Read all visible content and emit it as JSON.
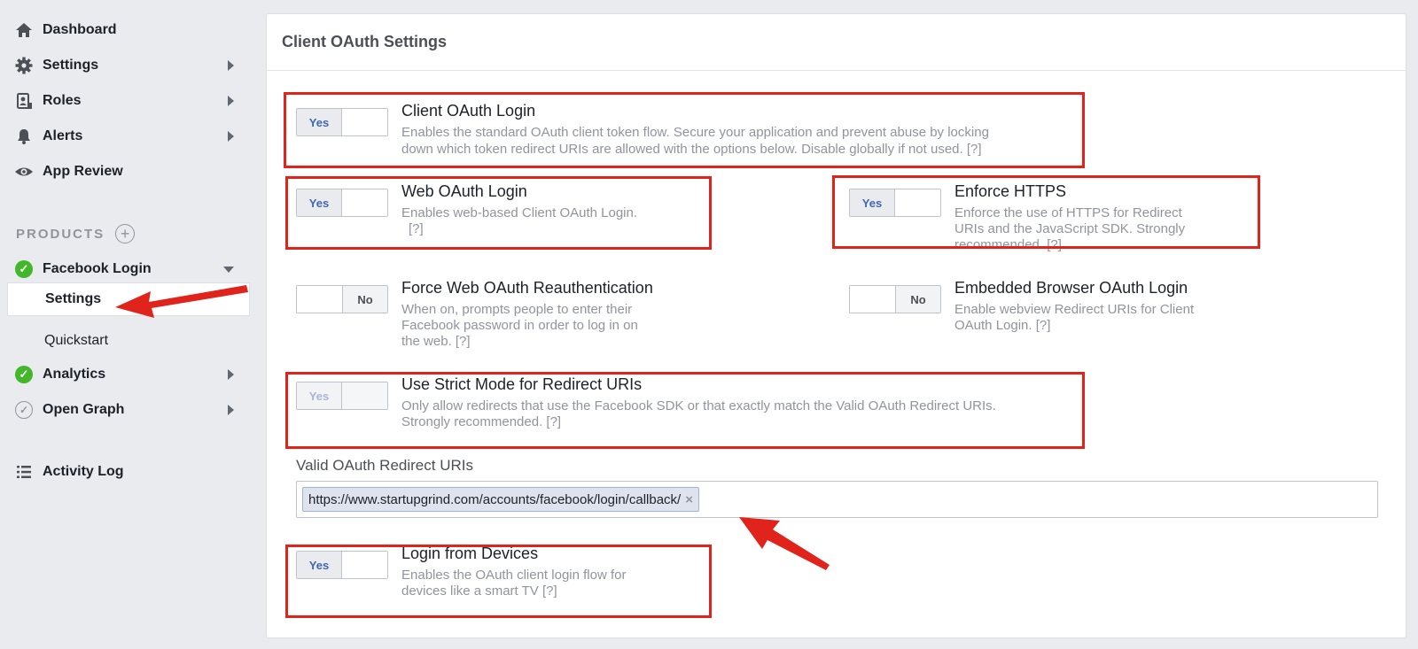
{
  "sidebar": {
    "nav": [
      {
        "label": "Dashboard",
        "icon": "home-icon"
      },
      {
        "label": "Settings",
        "icon": "gear-icon"
      },
      {
        "label": "Roles",
        "icon": "badge-icon"
      },
      {
        "label": "Alerts",
        "icon": "bell-icon"
      },
      {
        "label": "App Review",
        "icon": "eye-icon"
      }
    ],
    "products_heading": "PRODUCTS",
    "products": [
      {
        "label": "Facebook Login",
        "status": "active"
      },
      {
        "label": "Analytics",
        "status": "active"
      },
      {
        "label": "Open Graph",
        "status": "inactive"
      }
    ],
    "facebook_login_sub": [
      {
        "label": "Settings"
      },
      {
        "label": "Quickstart"
      }
    ],
    "activity_log": "Activity Log"
  },
  "panel": {
    "title": "Client OAuth Settings",
    "settings": {
      "client_oauth": {
        "title": "Client OAuth Login",
        "desc_line1": "Enables the standard OAuth client token flow. Secure your application and prevent abuse by locking",
        "desc_line2": "down which token redirect URIs are allowed with the options below. Disable globally if not used.  [?]",
        "value": "Yes"
      },
      "web_oauth": {
        "title": "Web OAuth Login",
        "desc_line1": "Enables web-based Client OAuth Login.",
        "desc_line2": "[?]",
        "value": "Yes"
      },
      "enforce_https": {
        "title": "Enforce HTTPS",
        "desc_line1": "Enforce the use of HTTPS for Redirect",
        "desc_line2": "URIs and the JavaScript SDK. Strongly",
        "desc_line3": "recommended.  [?]",
        "value": "Yes"
      },
      "force_reauth": {
        "title": "Force Web OAuth Reauthentication",
        "desc_line1": "When on, prompts people to enter their",
        "desc_line2": "Facebook password in order to log in on",
        "desc_line3": "the web.  [?]",
        "value": "No"
      },
      "embedded_browser": {
        "title": "Embedded Browser OAuth Login",
        "desc_line1": "Enable webview Redirect URIs for Client",
        "desc_line2": "OAuth Login.  [?]",
        "value": "No"
      },
      "strict_mode": {
        "title": "Use Strict Mode for Redirect URIs",
        "desc_line1": "Only allow redirects that use the Facebook SDK or that exactly match the Valid OAuth Redirect URIs.",
        "desc_line2": "Strongly recommended.  [?]",
        "value": "Yes"
      },
      "login_devices": {
        "title": "Login from Devices",
        "desc_line1": "Enables the OAuth client login flow for",
        "desc_line2": "devices like a smart TV [?]",
        "value": "Yes"
      }
    },
    "redirect_uris": {
      "label": "Valid OAuth Redirect URIs",
      "tokens": [
        "https://www.startupgrind.com/accounts/facebook/login/callback/"
      ]
    }
  },
  "colors": {
    "highlight": "#e0241b",
    "accent": "#4267b2",
    "check": "#42b72a"
  }
}
